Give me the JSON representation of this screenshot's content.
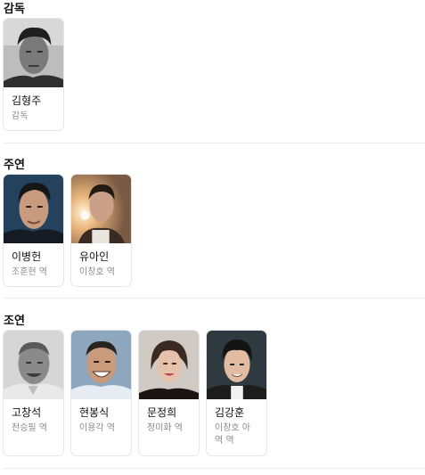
{
  "sections": {
    "director": {
      "title": "감독",
      "people": [
        {
          "name": "김형주",
          "role": "감독"
        }
      ]
    },
    "lead": {
      "title": "주연",
      "people": [
        {
          "name": "이병헌",
          "role": "조훈현 역"
        },
        {
          "name": "유아인",
          "role": "이창호 역"
        }
      ]
    },
    "supporting": {
      "title": "조연",
      "people": [
        {
          "name": "고창석",
          "role": "천승필 역"
        },
        {
          "name": "현봉식",
          "role": "이용각 역"
        },
        {
          "name": "문정희",
          "role": "정미화 역"
        },
        {
          "name": "김강훈",
          "role": "이창호 아역 역"
        }
      ]
    }
  }
}
